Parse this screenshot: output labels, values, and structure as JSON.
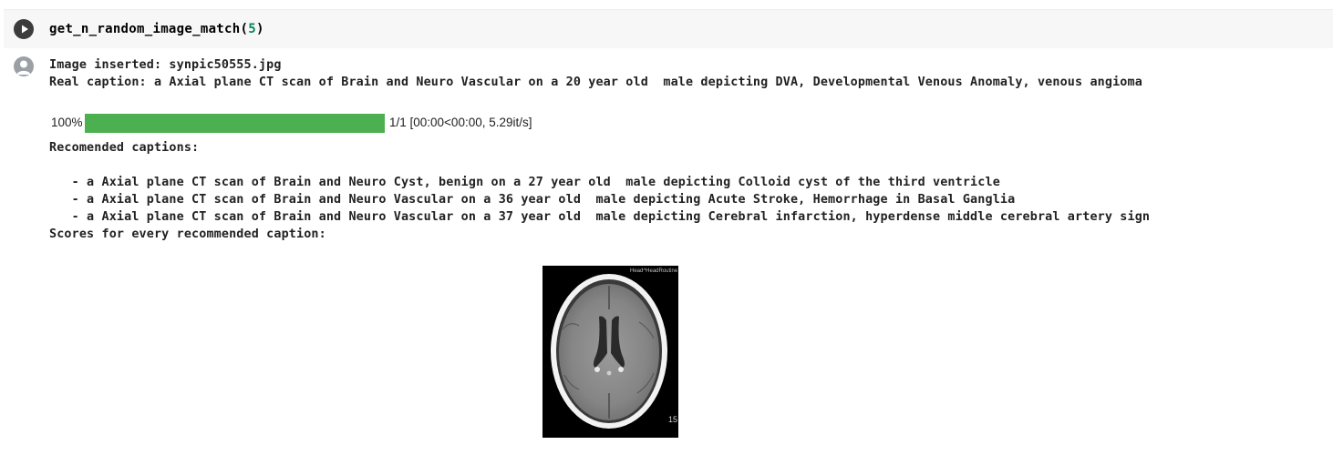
{
  "code_cell": {
    "function_name": "get_n_random_image_match(",
    "argument": "5",
    "closing": ")"
  },
  "output": {
    "image_inserted": "Image inserted: synpic50555.jpg",
    "real_caption": "Real caption: a Axial plane CT scan of Brain and Neuro Vascular on a 20 year old  male depicting DVA, Developmental Venous Anomaly, venous angioma",
    "progress": {
      "percent_label": "100%",
      "fraction": 1.0,
      "info": "1/1 [00:00<00:00, 5.29it/s]",
      "color": "#4caf50"
    },
    "recommended_header": "Recomended captions:",
    "recommended_captions": [
      "   - a Axial plane CT scan of Brain and Neuro Cyst, benign on a 27 year old  male depicting Colloid cyst of the third ventricle",
      "   - a Axial plane CT scan of Brain and Neuro Vascular on a 36 year old  male depicting Acute Stroke, Hemorrhage in Basal Ganglia",
      "   - a Axial plane CT scan of Brain and Neuro Vascular on a 37 year old  male depicting Cerebral infarction, hyperdense middle cerebral artery sign"
    ],
    "scores_header": "Scores for every recommended caption:",
    "image": {
      "corner_label_top": "Head^HeadRoutine",
      "corner_label_bottom": "15"
    }
  },
  "icons": {
    "run": "play-icon",
    "output_avatar": "user-avatar-icon"
  }
}
